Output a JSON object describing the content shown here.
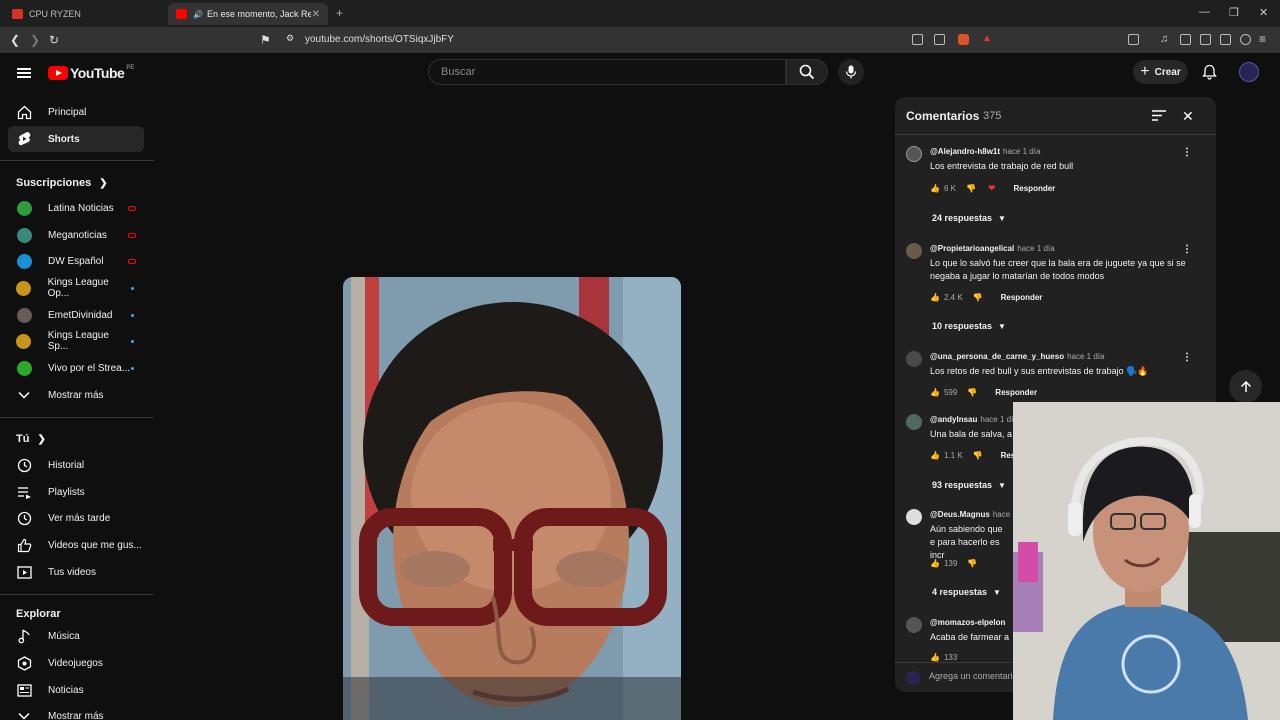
{
  "browser": {
    "tabs": [
      {
        "title": "CPU RYZEN",
        "favicon_color": "#d93025"
      },
      {
        "title": "En ese momento, Jack Reache",
        "favicon_color": "#ff0000"
      }
    ],
    "url": "youtube.com/shorts/OTSiqxJjbFY"
  },
  "header": {
    "logo_text": "YouTube",
    "country_code": "PE",
    "search_placeholder": "Buscar",
    "create_label": "Crear"
  },
  "sidebar": {
    "main": [
      {
        "label": "Principal",
        "icon": "home-icon"
      },
      {
        "label": "Shorts",
        "icon": "shorts-icon"
      }
    ],
    "subscriptions_title": "Suscripciones",
    "subscriptions": [
      {
        "label": "Latina Noticias",
        "color": "#2e9c3a",
        "status": "live"
      },
      {
        "label": "Meganoticias",
        "color": "#3a8a7a",
        "status": "live"
      },
      {
        "label": "DW Español",
        "color": "#1a8fd8",
        "status": "live"
      },
      {
        "label": "Kings League Op...",
        "color": "#c9941a",
        "status": "new"
      },
      {
        "label": "EmetDivinidad",
        "color": "#6b5a5a",
        "status": "new"
      },
      {
        "label": "Kings League Sp...",
        "color": "#c9941a",
        "status": "new"
      },
      {
        "label": "Vivo por el Strea...",
        "color": "#2aa82a",
        "status": "new"
      }
    ],
    "show_more": "Mostrar más",
    "you_title": "Tú",
    "you": [
      {
        "label": "Historial",
        "icon": "history-icon"
      },
      {
        "label": "Playlists",
        "icon": "playlists-icon"
      },
      {
        "label": "Ver más tarde",
        "icon": "watch-later-icon"
      },
      {
        "label": "Videos que me gus...",
        "icon": "liked-icon"
      },
      {
        "label": "Tus videos",
        "icon": "your-videos-icon"
      }
    ],
    "explore_title": "Explorar",
    "explore": [
      {
        "label": "Música",
        "icon": "music-icon"
      },
      {
        "label": "Videojuegos",
        "icon": "gaming-icon"
      },
      {
        "label": "Noticias",
        "icon": "news-icon"
      }
    ],
    "show_more_2": "Mostrar más"
  },
  "comments": {
    "title": "Comentarios",
    "count": "375",
    "reply_label": "Responder",
    "input_placeholder": "Agrega un comentario...",
    "items": [
      {
        "author": "@Alejandro-h8w1t",
        "time": "hace 1 día",
        "text": "Los entrevista de trabajo de red bull",
        "likes": "6 K",
        "replies": "24 respuestas",
        "avatar_color": "#555",
        "creator_heart": true
      },
      {
        "author": "@Propietarioangelical",
        "time": "hace 1 día",
        "text": "Lo que lo salvó fue creer que la bala era de juguete ya que si se negaba a jugar lo matarían de todos modos",
        "likes": "2.4 K",
        "replies": "10 respuestas",
        "avatar_color": "#6a5a4a",
        "creator_heart": false
      },
      {
        "author": "@una_persona_de_carne_y_hueso",
        "time": "hace 1 día",
        "text": "Los retos de red bull y sus entrevistas de trabajo 🗣️🔥",
        "likes": "599",
        "replies": "",
        "avatar_color": "#4a4a4a",
        "creator_heart": false
      },
      {
        "author": "@andylnsau",
        "time": "hace 1 día",
        "text": "Una bala de salva, a",
        "likes": "1.1 K",
        "replies": "93 respuestas",
        "avatar_color": "#4f6a5a",
        "creator_heart": false
      },
      {
        "author": "@Deus.Magnus",
        "time": "hace",
        "text": "Aún sabiendo que e para hacerlo es incr",
        "likes": "139",
        "replies": "4 respuestas",
        "avatar_color": "#ddd",
        "creator_heart": false
      },
      {
        "author": "@momazos-elpelon",
        "time": "",
        "text": "Acaba de farmear a",
        "likes": "133",
        "replies": "",
        "avatar_color": "#555",
        "creator_heart": false
      }
    ]
  }
}
